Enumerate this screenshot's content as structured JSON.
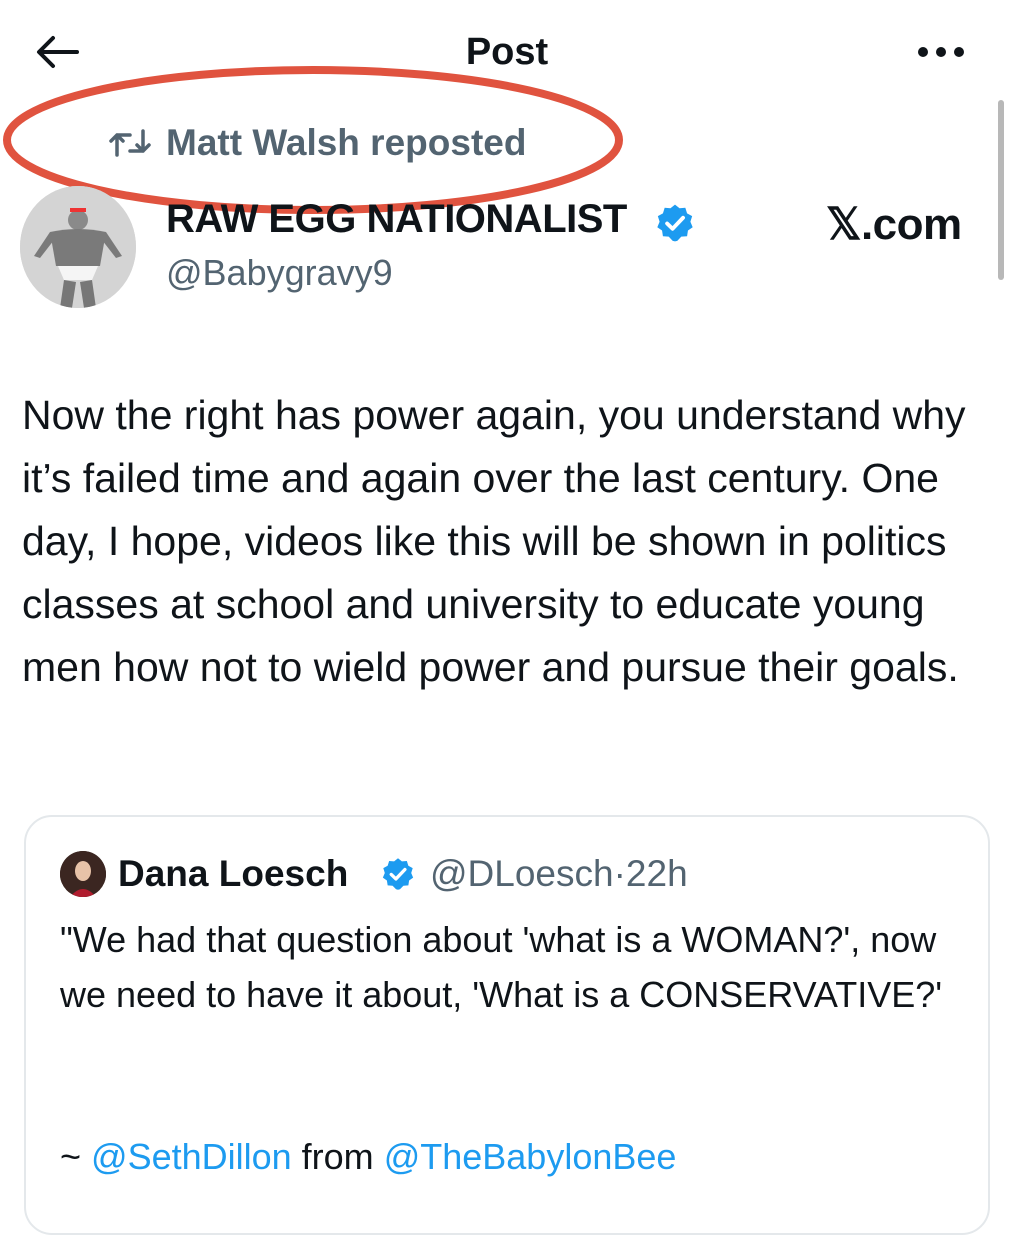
{
  "header": {
    "title": "Post",
    "back_icon": "back-arrow-icon",
    "more_icon": "more-icon"
  },
  "repost": {
    "text": "Matt Walsh reposted",
    "icon": "repost-icon",
    "highlight_color": "#e0533f"
  },
  "author": {
    "display_name": "RAW EGG NATIONALIST",
    "handle": "@Babygravy9",
    "verified": true
  },
  "watermark": "𝕏.com",
  "post": {
    "text": "Now the right has power again, you understand why it’s failed time and again over the last century. One day, I hope, videos like this will be shown in politics classes at school and university to educate young men how not to wield power and pursue their goals."
  },
  "quote": {
    "author_name": "Dana Loesch",
    "handle": "@DLoesch",
    "separator": "·",
    "time": "22h",
    "text": "\"We had that question about 'what is a WOMAN?', now we need to have it about, 'What is a CONSERVATIVE?'",
    "mention_prefix": "~ ",
    "mention1": "@SethDillon",
    "mention_mid": " from ",
    "mention2": "@TheBabylonBee"
  },
  "colors": {
    "text": "#0f1419",
    "secondary": "#536471",
    "accent_blue": "#1d9bf0",
    "border": "#e4e8eb"
  }
}
